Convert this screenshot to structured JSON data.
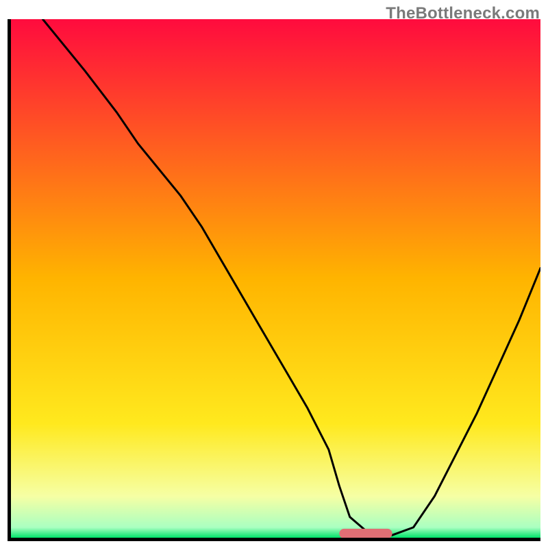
{
  "watermark": "TheBottleneck.com",
  "colors": {
    "gradient_stops": [
      {
        "offset": 0.0,
        "color": "#ff0b3e"
      },
      {
        "offset": 0.5,
        "color": "#ffb400"
      },
      {
        "offset": 0.78,
        "color": "#ffe91e"
      },
      {
        "offset": 0.92,
        "color": "#f6ffa4"
      },
      {
        "offset": 0.98,
        "color": "#aaffc1"
      },
      {
        "offset": 1.0,
        "color": "#00e26a"
      }
    ],
    "curve": "#000000",
    "marker": "#e06f74"
  },
  "chart_data": {
    "type": "line",
    "title": "",
    "xlabel": "",
    "ylabel": "",
    "xlim": [
      0,
      100
    ],
    "ylim": [
      0,
      100
    ],
    "grid": false,
    "legend": false,
    "series": [
      {
        "name": "bottleneck-curve",
        "x": [
          6,
          14,
          20,
          24,
          28,
          32,
          36,
          40,
          44,
          48,
          52,
          56,
          60,
          62,
          64,
          68,
          72,
          76,
          80,
          84,
          88,
          92,
          96,
          100
        ],
        "y": [
          100,
          90,
          82,
          76,
          71,
          66,
          60,
          53,
          46,
          39,
          32,
          25,
          17,
          10,
          4,
          0.5,
          0.5,
          2,
          8,
          16,
          24,
          33,
          42,
          52
        ]
      }
    ],
    "annotations": [
      {
        "name": "optimal-marker",
        "shape": "rounded-bar",
        "x_range": [
          62,
          72
        ],
        "y": 0.8
      }
    ]
  }
}
